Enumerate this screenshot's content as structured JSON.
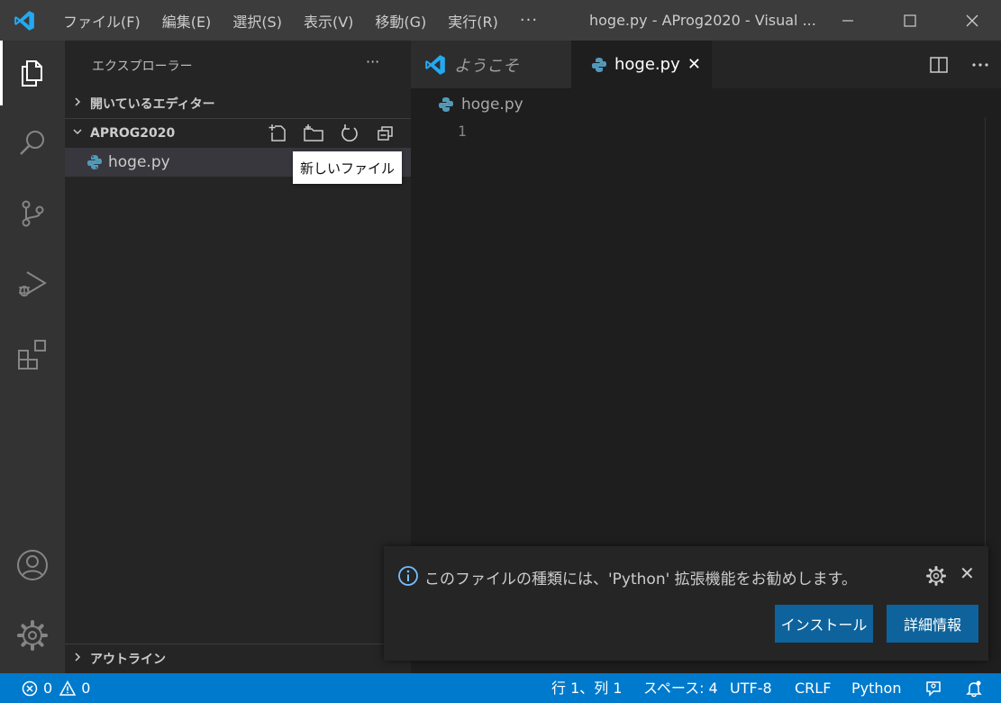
{
  "titlebar": {
    "menu": [
      "ファイル(F)",
      "編集(E)",
      "選択(S)",
      "表示(V)",
      "移動(G)",
      "実行(R)"
    ],
    "more": "···",
    "window_title": "hoge.py - AProg2020 - Visual ..."
  },
  "sidebar": {
    "title": "エクスプローラー",
    "more": "···",
    "open_editors_label": "開いているエディター",
    "folder_label": "APROG2020",
    "file_name": "hoge.py",
    "tooltip": "新しいファイル",
    "outline_label": "アウトライン"
  },
  "tabs": [
    {
      "label": "ようこそ",
      "active": false
    },
    {
      "label": "hoge.py",
      "active": true,
      "close": "✕"
    }
  ],
  "editor": {
    "breadcrumb": "hoge.py",
    "line_number": "1"
  },
  "notification": {
    "message": "このファイルの種類には、'Python' 拡張機能をお勧めします。",
    "close": "✕",
    "install_label": "インストール",
    "details_label": "詳細情報"
  },
  "statusbar": {
    "errors": "0",
    "warnings": "0",
    "position": "行 1、列 1",
    "spaces": "スペース: 4",
    "encoding": "UTF-8",
    "eol": "CRLF",
    "language": "Python"
  },
  "colors": {
    "accent": "#007acc",
    "button": "#0e639c",
    "vscode_blue": "#23a9f2",
    "python_icon": "#519aba"
  }
}
